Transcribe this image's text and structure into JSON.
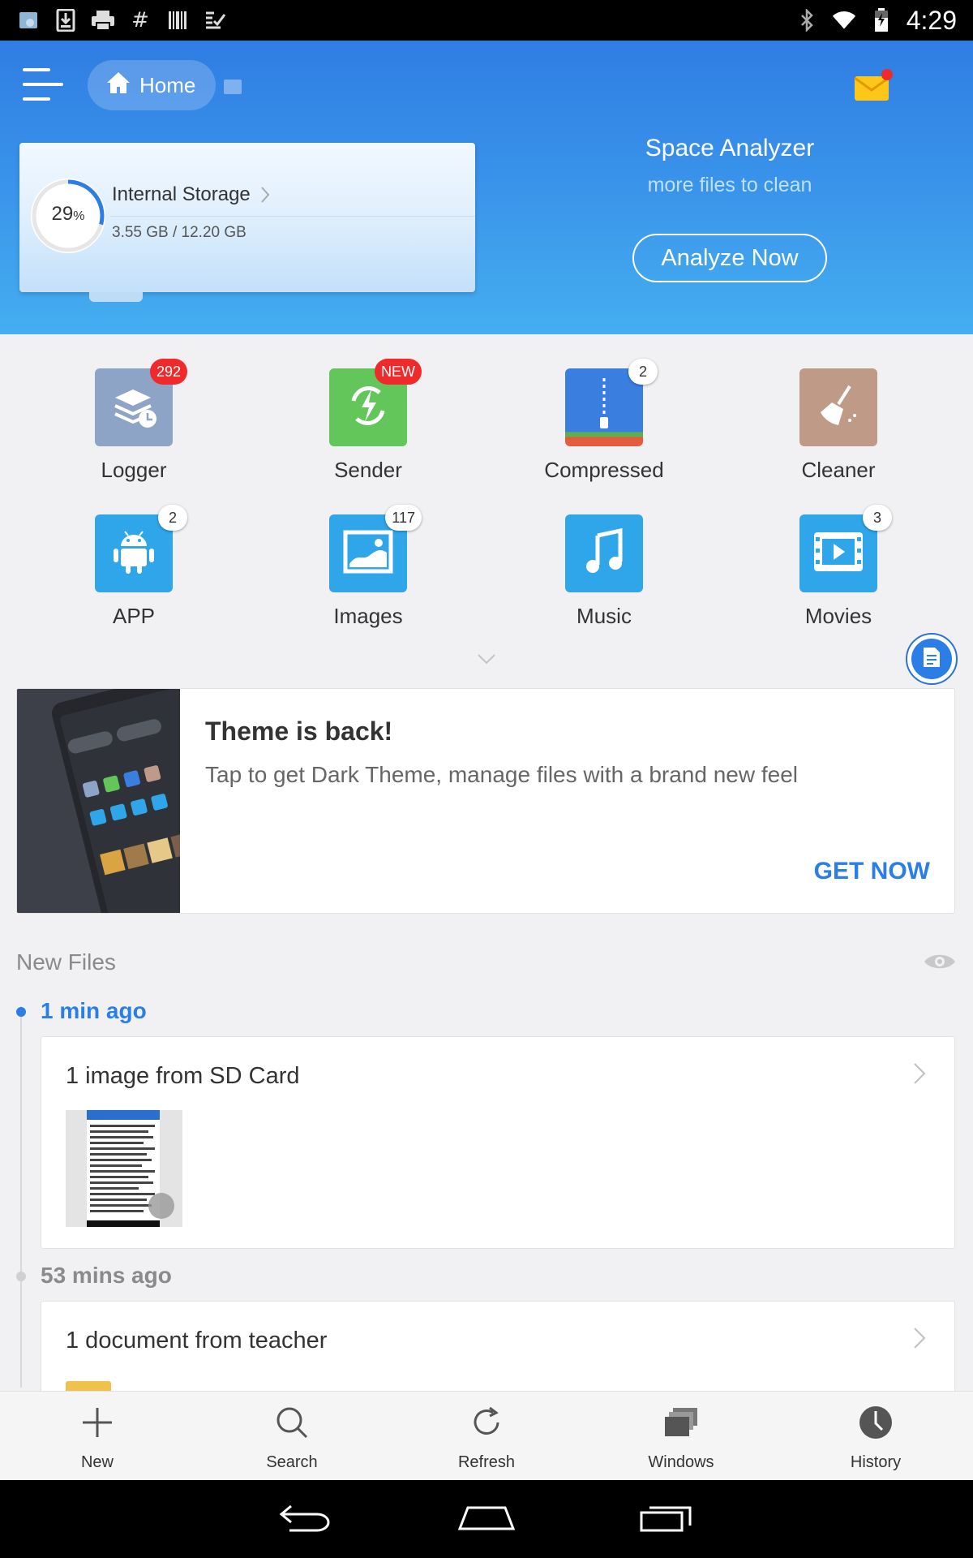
{
  "status_bar": {
    "time": "4:29",
    "left_icons": [
      "gallery-icon",
      "download-icon",
      "print-icon",
      "hashtag-icon",
      "barcode-icon",
      "check-list-icon"
    ],
    "right_icons": [
      "bluetooth-icon",
      "wifi-icon",
      "battery-icon"
    ]
  },
  "header": {
    "home_label": "Home",
    "storage": {
      "name": "Internal Storage",
      "percent": "29",
      "percent_sign": "%",
      "percent_value": 0.29,
      "size": "3.55 GB / 12.20 GB"
    },
    "analyzer": {
      "title": "Space Analyzer",
      "subtitle": "more files to clean",
      "button": "Analyze Now"
    }
  },
  "categories": [
    {
      "label": "Logger",
      "badge": "292",
      "badge_style": "red",
      "icon": "logger-icon"
    },
    {
      "label": "Sender",
      "badge": "NEW",
      "badge_style": "red",
      "icon": "sender-icon"
    },
    {
      "label": "Compressed",
      "badge": "2",
      "badge_style": "white",
      "icon": "zip-icon"
    },
    {
      "label": "Cleaner",
      "badge": "",
      "badge_style": "none",
      "icon": "broom-icon"
    },
    {
      "label": "APP",
      "badge": "2",
      "badge_style": "white",
      "icon": "android-icon"
    },
    {
      "label": "Images",
      "badge": "117",
      "badge_style": "white",
      "icon": "image-icon"
    },
    {
      "label": "Music",
      "badge": "",
      "badge_style": "none",
      "icon": "music-icon"
    },
    {
      "label": "Movies",
      "badge": "3",
      "badge_style": "white",
      "icon": "movie-icon"
    }
  ],
  "promo": {
    "title": "Theme is back!",
    "text": "Tap to get Dark Theme, manage files with a brand new feel",
    "cta": "GET NOW"
  },
  "new_files": {
    "heading": "New Files",
    "groups": [
      {
        "time": "1 min ago",
        "title": "1 image from SD Card"
      },
      {
        "time": "53 mins ago",
        "title": "1 document from teacher"
      }
    ]
  },
  "bottom_bar": [
    {
      "label": "New",
      "icon": "plus-icon"
    },
    {
      "label": "Search",
      "icon": "search-icon"
    },
    {
      "label": "Refresh",
      "icon": "refresh-icon"
    },
    {
      "label": "Windows",
      "icon": "windows-icon"
    },
    {
      "label": "History",
      "icon": "history-icon"
    }
  ],
  "colors": {
    "header_blue": "#2f7de3",
    "accent_blue": "#2a7ee6",
    "badge_red": "#f02a2a"
  }
}
